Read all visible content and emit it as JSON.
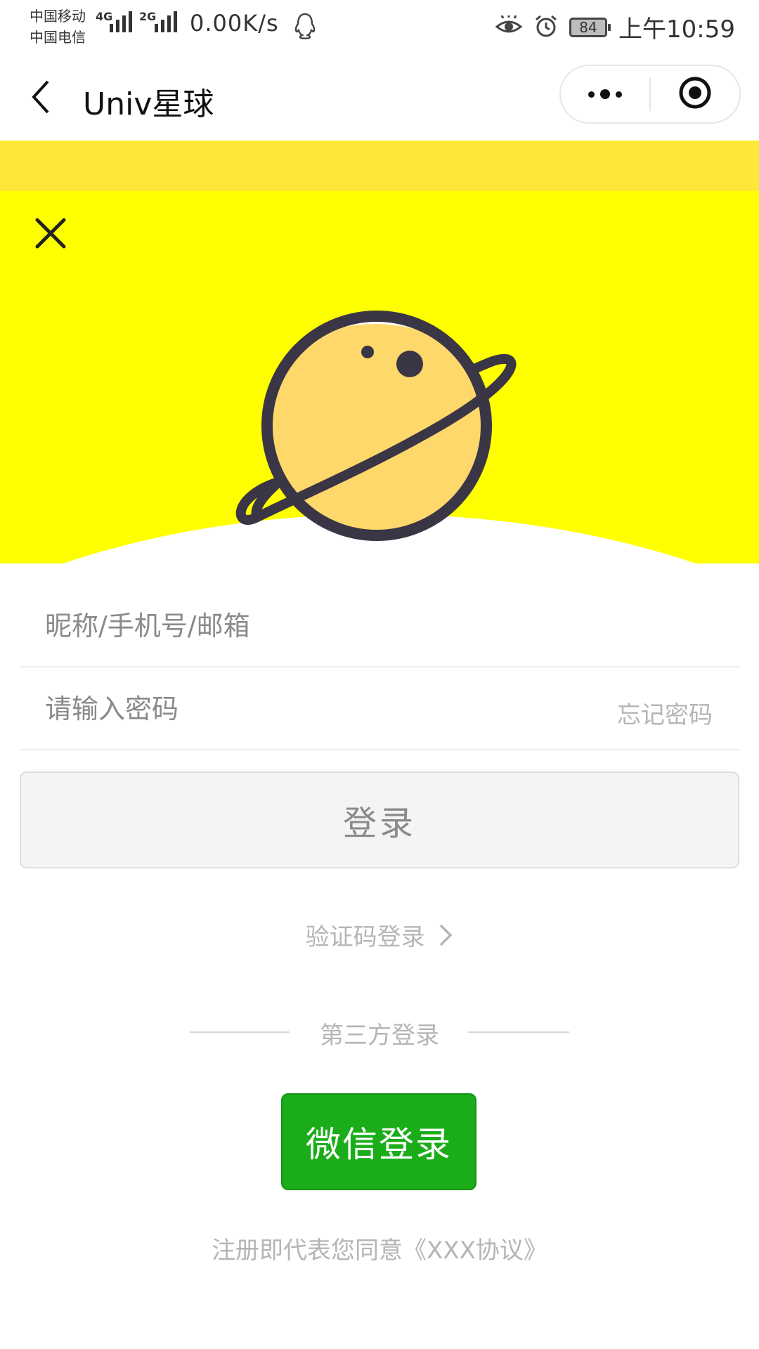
{
  "status_bar": {
    "carrier1": "中国移动",
    "carrier2": "中国电信",
    "net1": "4G",
    "net2": "2G",
    "speed": "0.00K/s",
    "battery": "84",
    "time": "上午10:59"
  },
  "navbar": {
    "title": "Univ星球",
    "icons": [
      "back-arrow-icon",
      "more-dots-icon",
      "target-close-icon"
    ]
  },
  "hero": {
    "colors": {
      "band": "#fde838",
      "background": "#ffff00",
      "planet": "#ffd86b",
      "outline": "#3a3646"
    },
    "icons": [
      "close-icon",
      "planet-logo"
    ]
  },
  "form": {
    "username_placeholder": "昵称/手机号/邮箱",
    "password_placeholder": "请输入密码",
    "forgot_label": "忘记密码",
    "login_label": "登录",
    "sms_login_label": "验证码登录",
    "third_party_label": "第三方登录",
    "wechat_login_label": "微信登录",
    "agreement_text": "注册即代表您同意《XXX协议》"
  },
  "colors": {
    "wechat_green": "#1aad19",
    "muted_text": "#b5b5b5"
  }
}
